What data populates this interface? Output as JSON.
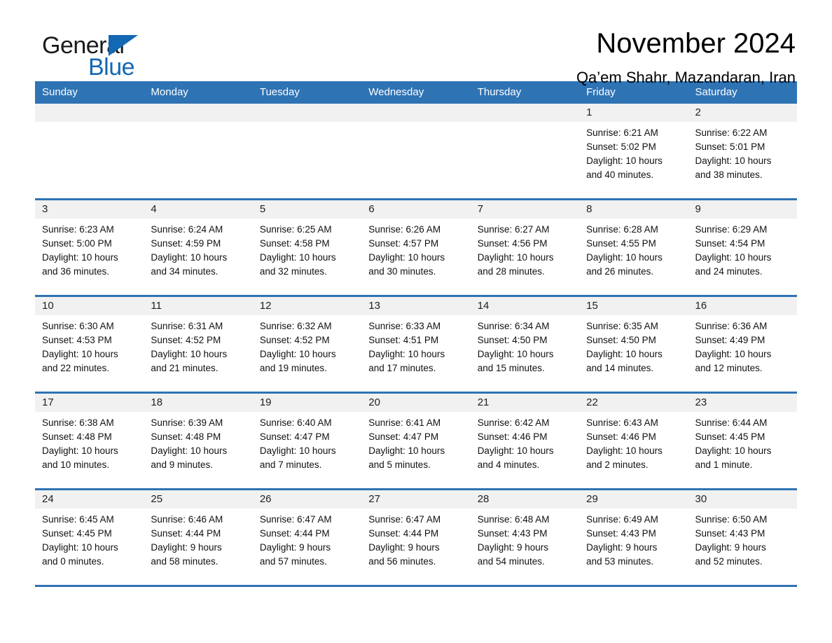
{
  "logo": {
    "word_one": "General",
    "word_two": "Blue",
    "triangle_color": "#1368b3",
    "blue_color": "#1368b3"
  },
  "header": {
    "month_title": "November 2024",
    "location": "Qa’em Shahr, Mazandaran, Iran"
  },
  "theme": {
    "header_blue": "#2e73b4",
    "daynum_band": "#f1f1f1",
    "page_background": "#ffffff"
  },
  "calendar": {
    "weekday_headers": [
      "Sunday",
      "Monday",
      "Tuesday",
      "Wednesday",
      "Thursday",
      "Friday",
      "Saturday"
    ],
    "weeks": [
      [
        {
          "day": "",
          "lines": [
            "",
            "",
            "",
            ""
          ],
          "empty": true
        },
        {
          "day": "",
          "lines": [
            "",
            "",
            "",
            ""
          ],
          "empty": true
        },
        {
          "day": "",
          "lines": [
            "",
            "",
            "",
            ""
          ],
          "empty": true
        },
        {
          "day": "",
          "lines": [
            "",
            "",
            "",
            ""
          ],
          "empty": true
        },
        {
          "day": "",
          "lines": [
            "",
            "",
            "",
            ""
          ],
          "empty": true
        },
        {
          "day": "1",
          "lines": [
            "Sunrise: 6:21 AM",
            "Sunset: 5:02 PM",
            "Daylight: 10 hours",
            "and 40 minutes."
          ],
          "empty": false
        },
        {
          "day": "2",
          "lines": [
            "Sunrise: 6:22 AM",
            "Sunset: 5:01 PM",
            "Daylight: 10 hours",
            "and 38 minutes."
          ],
          "empty": false
        }
      ],
      [
        {
          "day": "3",
          "lines": [
            "Sunrise: 6:23 AM",
            "Sunset: 5:00 PM",
            "Daylight: 10 hours",
            "and 36 minutes."
          ],
          "empty": false
        },
        {
          "day": "4",
          "lines": [
            "Sunrise: 6:24 AM",
            "Sunset: 4:59 PM",
            "Daylight: 10 hours",
            "and 34 minutes."
          ],
          "empty": false
        },
        {
          "day": "5",
          "lines": [
            "Sunrise: 6:25 AM",
            "Sunset: 4:58 PM",
            "Daylight: 10 hours",
            "and 32 minutes."
          ],
          "empty": false
        },
        {
          "day": "6",
          "lines": [
            "Sunrise: 6:26 AM",
            "Sunset: 4:57 PM",
            "Daylight: 10 hours",
            "and 30 minutes."
          ],
          "empty": false
        },
        {
          "day": "7",
          "lines": [
            "Sunrise: 6:27 AM",
            "Sunset: 4:56 PM",
            "Daylight: 10 hours",
            "and 28 minutes."
          ],
          "empty": false
        },
        {
          "day": "8",
          "lines": [
            "Sunrise: 6:28 AM",
            "Sunset: 4:55 PM",
            "Daylight: 10 hours",
            "and 26 minutes."
          ],
          "empty": false
        },
        {
          "day": "9",
          "lines": [
            "Sunrise: 6:29 AM",
            "Sunset: 4:54 PM",
            "Daylight: 10 hours",
            "and 24 minutes."
          ],
          "empty": false
        }
      ],
      [
        {
          "day": "10",
          "lines": [
            "Sunrise: 6:30 AM",
            "Sunset: 4:53 PM",
            "Daylight: 10 hours",
            "and 22 minutes."
          ],
          "empty": false
        },
        {
          "day": "11",
          "lines": [
            "Sunrise: 6:31 AM",
            "Sunset: 4:52 PM",
            "Daylight: 10 hours",
            "and 21 minutes."
          ],
          "empty": false
        },
        {
          "day": "12",
          "lines": [
            "Sunrise: 6:32 AM",
            "Sunset: 4:52 PM",
            "Daylight: 10 hours",
            "and 19 minutes."
          ],
          "empty": false
        },
        {
          "day": "13",
          "lines": [
            "Sunrise: 6:33 AM",
            "Sunset: 4:51 PM",
            "Daylight: 10 hours",
            "and 17 minutes."
          ],
          "empty": false
        },
        {
          "day": "14",
          "lines": [
            "Sunrise: 6:34 AM",
            "Sunset: 4:50 PM",
            "Daylight: 10 hours",
            "and 15 minutes."
          ],
          "empty": false
        },
        {
          "day": "15",
          "lines": [
            "Sunrise: 6:35 AM",
            "Sunset: 4:50 PM",
            "Daylight: 10 hours",
            "and 14 minutes."
          ],
          "empty": false
        },
        {
          "day": "16",
          "lines": [
            "Sunrise: 6:36 AM",
            "Sunset: 4:49 PM",
            "Daylight: 10 hours",
            "and 12 minutes."
          ],
          "empty": false
        }
      ],
      [
        {
          "day": "17",
          "lines": [
            "Sunrise: 6:38 AM",
            "Sunset: 4:48 PM",
            "Daylight: 10 hours",
            "and 10 minutes."
          ],
          "empty": false
        },
        {
          "day": "18",
          "lines": [
            "Sunrise: 6:39 AM",
            "Sunset: 4:48 PM",
            "Daylight: 10 hours",
            "and 9 minutes."
          ],
          "empty": false
        },
        {
          "day": "19",
          "lines": [
            "Sunrise: 6:40 AM",
            "Sunset: 4:47 PM",
            "Daylight: 10 hours",
            "and 7 minutes."
          ],
          "empty": false
        },
        {
          "day": "20",
          "lines": [
            "Sunrise: 6:41 AM",
            "Sunset: 4:47 PM",
            "Daylight: 10 hours",
            "and 5 minutes."
          ],
          "empty": false
        },
        {
          "day": "21",
          "lines": [
            "Sunrise: 6:42 AM",
            "Sunset: 4:46 PM",
            "Daylight: 10 hours",
            "and 4 minutes."
          ],
          "empty": false
        },
        {
          "day": "22",
          "lines": [
            "Sunrise: 6:43 AM",
            "Sunset: 4:46 PM",
            "Daylight: 10 hours",
            "and 2 minutes."
          ],
          "empty": false
        },
        {
          "day": "23",
          "lines": [
            "Sunrise: 6:44 AM",
            "Sunset: 4:45 PM",
            "Daylight: 10 hours",
            "and 1 minute."
          ],
          "empty": false
        }
      ],
      [
        {
          "day": "24",
          "lines": [
            "Sunrise: 6:45 AM",
            "Sunset: 4:45 PM",
            "Daylight: 10 hours",
            "and 0 minutes."
          ],
          "empty": false
        },
        {
          "day": "25",
          "lines": [
            "Sunrise: 6:46 AM",
            "Sunset: 4:44 PM",
            "Daylight: 9 hours",
            "and 58 minutes."
          ],
          "empty": false
        },
        {
          "day": "26",
          "lines": [
            "Sunrise: 6:47 AM",
            "Sunset: 4:44 PM",
            "Daylight: 9 hours",
            "and 57 minutes."
          ],
          "empty": false
        },
        {
          "day": "27",
          "lines": [
            "Sunrise: 6:47 AM",
            "Sunset: 4:44 PM",
            "Daylight: 9 hours",
            "and 56 minutes."
          ],
          "empty": false
        },
        {
          "day": "28",
          "lines": [
            "Sunrise: 6:48 AM",
            "Sunset: 4:43 PM",
            "Daylight: 9 hours",
            "and 54 minutes."
          ],
          "empty": false
        },
        {
          "day": "29",
          "lines": [
            "Sunrise: 6:49 AM",
            "Sunset: 4:43 PM",
            "Daylight: 9 hours",
            "and 53 minutes."
          ],
          "empty": false
        },
        {
          "day": "30",
          "lines": [
            "Sunrise: 6:50 AM",
            "Sunset: 4:43 PM",
            "Daylight: 9 hours",
            "and 52 minutes."
          ],
          "empty": false
        }
      ]
    ]
  }
}
